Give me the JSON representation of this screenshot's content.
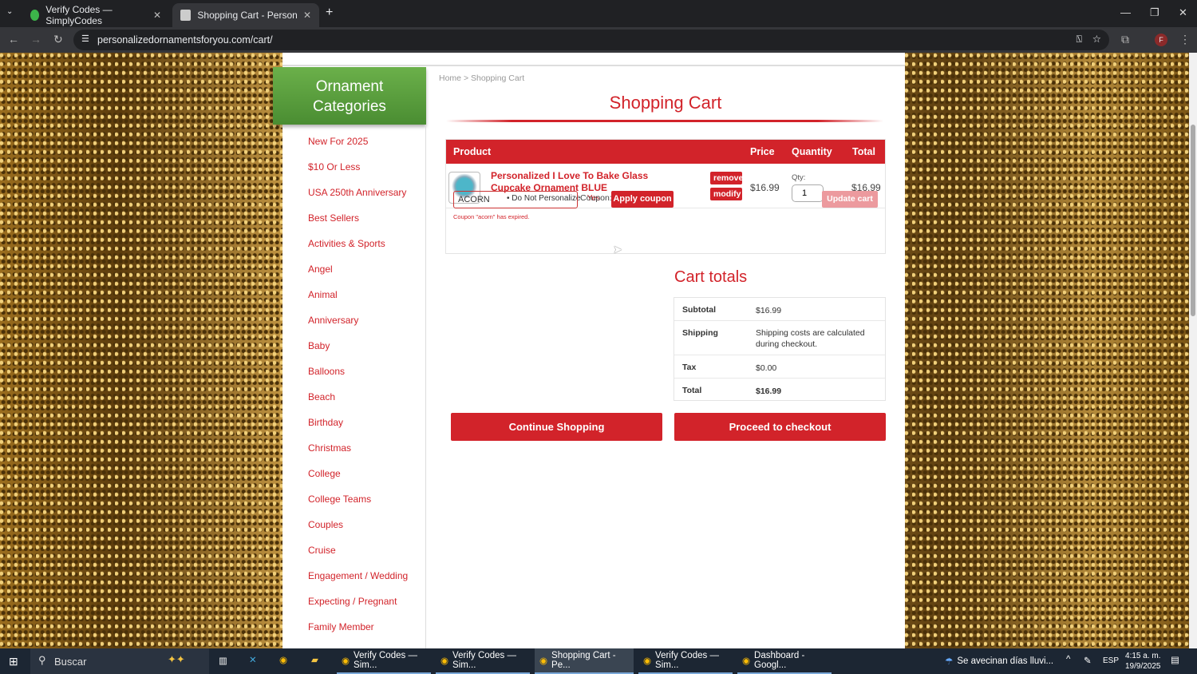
{
  "browser": {
    "tabs": [
      {
        "title": "Verify Codes — SimplyCodes",
        "active": false
      },
      {
        "title": "Shopping Cart - Personalized O",
        "active": true
      }
    ],
    "url": "personalizedornamentsforyou.com/cart/"
  },
  "sidebar": {
    "title": "Ornament Categories",
    "items": [
      "New For 2025",
      "$10 Or Less",
      "USA 250th Anniversary",
      "Best Sellers",
      "Activities & Sports",
      "Angel",
      "Animal",
      "Anniversary",
      "Baby",
      "Balloons",
      "Beach",
      "Birthday",
      "Christmas",
      "College",
      "College Teams",
      "Couples",
      "Cruise",
      "Engagement / Wedding",
      "Expecting / Pregnant",
      "Family Member"
    ]
  },
  "breadcrumb": {
    "home": "Home",
    "sep": ">",
    "current": "Shopping Cart"
  },
  "page_title": "Shopping Cart",
  "cart": {
    "headers": {
      "product": "Product",
      "price": "Price",
      "quantity": "Quantity",
      "total": "Total"
    },
    "item": {
      "name": "Personalized I Love To Bake Glass Cupcake Ornament BLUE",
      "option_label": "Do Not Personalize",
      "option_value": "Yes",
      "remove": "remove",
      "modify": "modify",
      "price": "$16.99",
      "qty_label": "Qty:",
      "qty": "1",
      "total": "$16.99"
    },
    "coupon_value": "ACORN",
    "coupon_label": "Coupon:",
    "apply": "Apply coupon",
    "update": "Update cart",
    "error": "Coupon \"acorn\" has expired."
  },
  "totals": {
    "title": "Cart totals",
    "subtotal_label": "Subtotal",
    "subtotal": "$16.99",
    "shipping_label": "Shipping",
    "shipping": "Shipping costs are calculated during checkout.",
    "tax_label": "Tax",
    "tax": "$0.00",
    "total_label": "Total",
    "total": "$16.99"
  },
  "buttons": {
    "continue": "Continue Shopping",
    "checkout": "Proceed to checkout"
  },
  "taskbar": {
    "search": "Buscar",
    "apps": [
      "Verify Codes — Sim...",
      "Verify Codes — Sim...",
      "Shopping Cart - Pe...",
      "Verify Codes — Sim...",
      "Dashboard - Googl..."
    ],
    "weather": "Se avecinan días lluvi...",
    "lang": "ESP",
    "time": "4:15 a. m.",
    "date": "19/9/2025"
  },
  "colors": {
    "accent": "#d2232a",
    "green": "#5a9e3c"
  }
}
